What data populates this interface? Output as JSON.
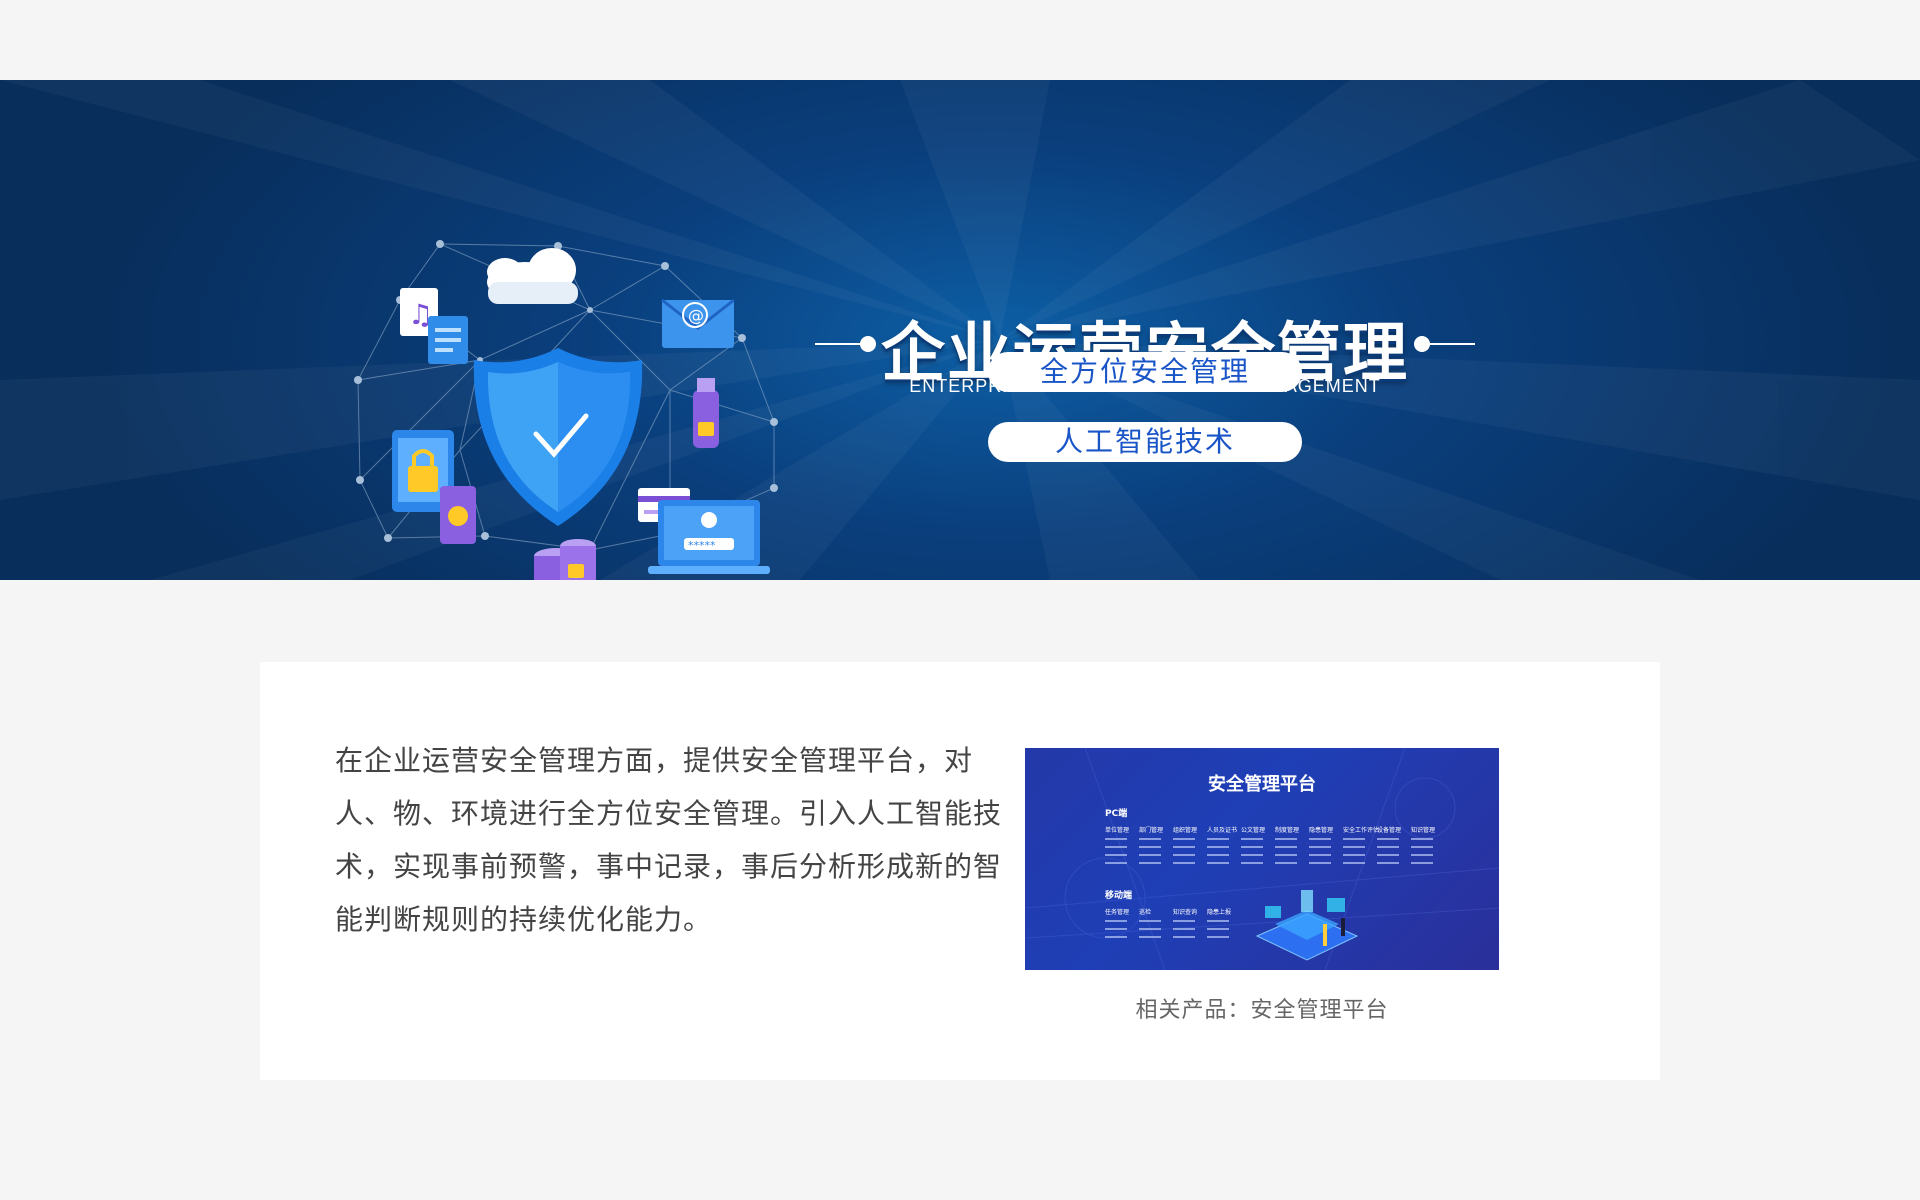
{
  "banner": {
    "title_cn": "企业运营安全管理",
    "title_en": "ENTERPRISE OPERATION SAFETY MANAGEMENT",
    "pills": [
      "全方位安全管理",
      "人工智能技术"
    ],
    "illustration_icons": [
      "network-mesh",
      "shield-check-icon",
      "cloud-icon",
      "music-file-icon",
      "document-icon",
      "email-icon",
      "usb-lock-icon",
      "tablet-lock-icon",
      "phone-fingerprint-icon",
      "database-lock-icon",
      "laptop-login-icon",
      "card-icon"
    ],
    "password_mask": "*****",
    "colors": {
      "bg_dark": "#082e5c",
      "bg_mid": "#0d5fa6",
      "pill_text": "#1a55c8"
    }
  },
  "content": {
    "description": "在企业运营安全管理方面，提供安全管理平台，对人、物、环境进行全方位安全管理。引入人工智能技术，实现事前预警，事中记录，事后分析形成新的智能判断规则的持续优化能力。",
    "product_caption": "相关产品：安全管理平台",
    "product_image": {
      "title": "安全管理平台",
      "pc_section": "PC端",
      "pc_columns": [
        "单位管理",
        "部门管理",
        "组织管理",
        "人员及证书",
        "公文管理",
        "制度管理",
        "隐患管理",
        "安全工作评估",
        "设备管理",
        "知识管理"
      ],
      "mobile_section": "移动端",
      "mobile_columns": [
        "任务管理",
        "巡检",
        "知识查询",
        "隐患上报"
      ]
    }
  }
}
